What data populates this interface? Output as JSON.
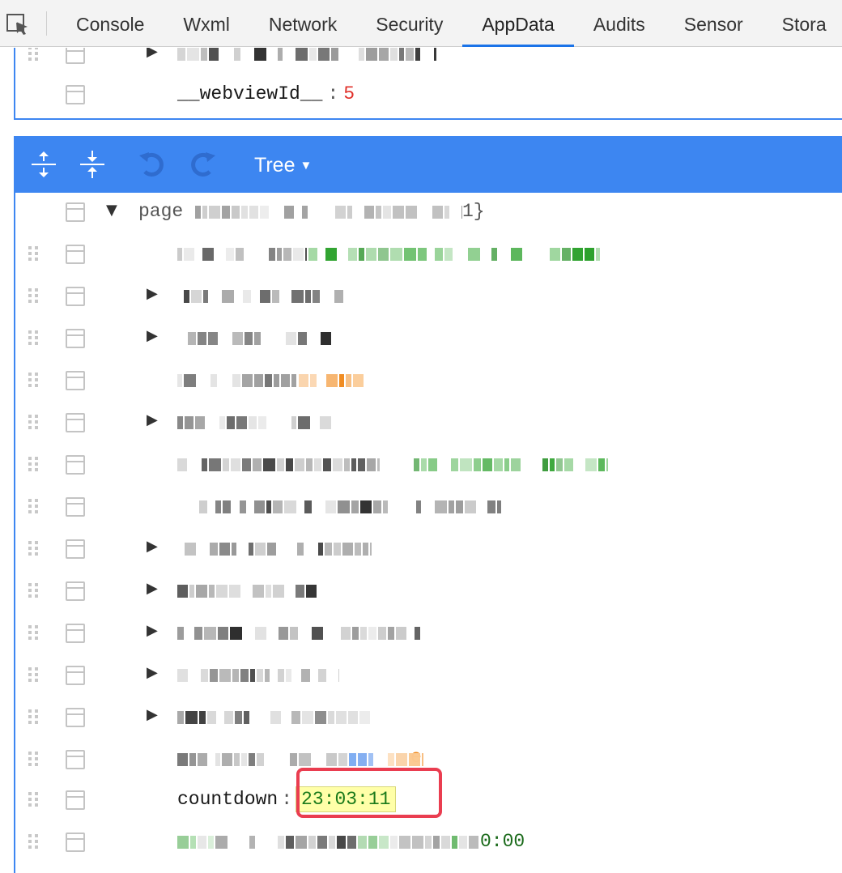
{
  "tabs": [
    {
      "label": "Console",
      "active": false
    },
    {
      "label": "Wxml",
      "active": false
    },
    {
      "label": "Network",
      "active": false
    },
    {
      "label": "Security",
      "active": false
    },
    {
      "label": "AppData",
      "active": true
    },
    {
      "label": "Audits",
      "active": false
    },
    {
      "label": "Sensor",
      "active": false
    },
    {
      "label": "Stora",
      "active": false
    }
  ],
  "top_pane": {
    "webview_key": "__webviewId__",
    "webview_sep": ":",
    "webview_value": "5"
  },
  "editor_toolbar": {
    "mode_label": "Tree",
    "icons": [
      "expand-all-icon",
      "collapse-all-icon",
      "undo-icon",
      "redo-icon"
    ]
  },
  "tree": {
    "root_key": "page",
    "root_tail": "1}",
    "countdown_key": "countdown",
    "countdown_sep": ":",
    "countdown_value": "23:03:11",
    "last_row_tail": "0:00",
    "partial_char": "e"
  },
  "colors": {
    "accent": "#3d86f1",
    "tab_underline": "#1a73e8",
    "highlight_border": "#ea3d50",
    "number_value": "#e0302a",
    "string_value": "#1a8a1a"
  }
}
